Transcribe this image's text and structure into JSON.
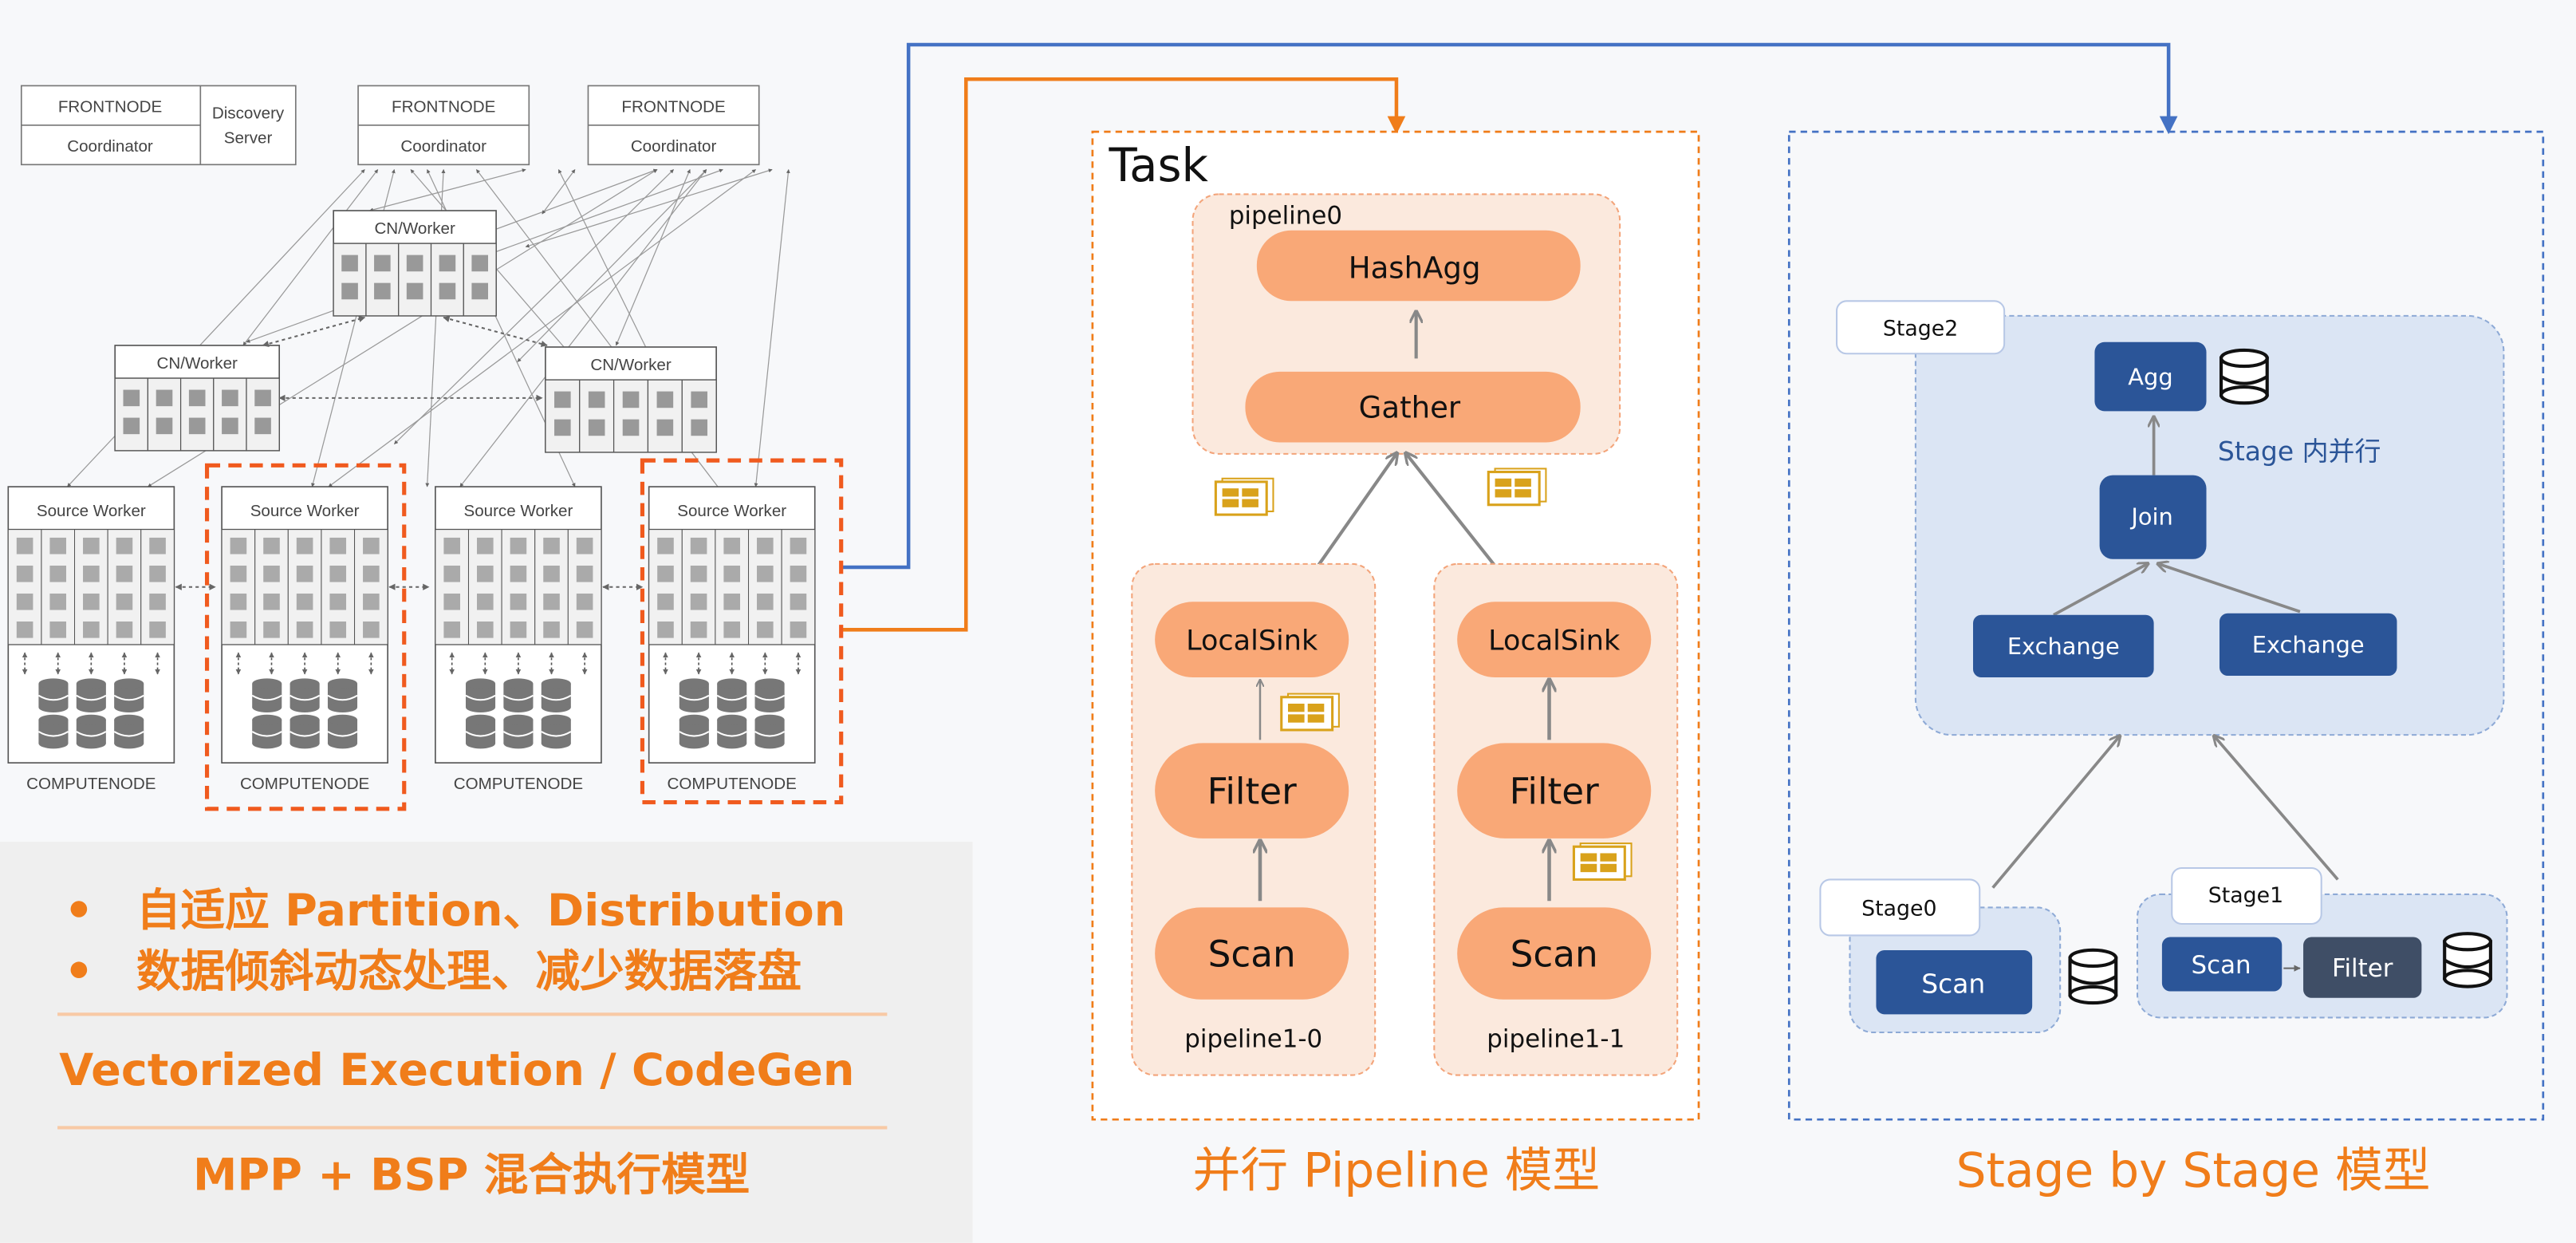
{
  "cluster": {
    "frontnodes": [
      {
        "title": "FRONTNODE",
        "role": "Coordinator"
      },
      {
        "title": "FRONTNODE",
        "role": "Coordinator"
      },
      {
        "title": "FRONTNODE",
        "role": "Coordinator"
      }
    ],
    "discovery_server": [
      "Discovery",
      "Server"
    ],
    "cn_worker_label": "CN/Worker",
    "source_worker_label": "Source Worker",
    "computenode_label": "COMPUTENODE"
  },
  "highlights": {
    "bullets": [
      "自适应 Partition、Distribution",
      "数据倾斜动态处理、减少数据落盘"
    ],
    "line2": "Vectorized Execution  / CodeGen",
    "line3": "MPP + BSP 混合执行模型"
  },
  "pipeline_model": {
    "task_label": "Task",
    "pipeline0": {
      "label": "pipeline0",
      "ops": [
        "HashAgg",
        "Gather"
      ]
    },
    "pipeline1_0": {
      "label": "pipeline1-0",
      "ops": [
        "LocalSink",
        "Filter",
        "Scan"
      ]
    },
    "pipeline1_1": {
      "label": "pipeline1-1",
      "ops": [
        "LocalSink",
        "Filter",
        "Scan"
      ]
    },
    "caption": "并行 Pipeline 模型"
  },
  "stage_model": {
    "stage2": {
      "label": "Stage2",
      "ops": {
        "agg": "Agg",
        "join": "Join",
        "exchange_left": "Exchange",
        "exchange_right": "Exchange"
      },
      "note": "Stage 内并行"
    },
    "stage0": {
      "label": "Stage0",
      "ops": {
        "scan": "Scan"
      }
    },
    "stage1": {
      "label": "Stage1",
      "ops": {
        "scan": "Scan",
        "filter": "Filter"
      }
    },
    "caption": "Stage by Stage 模型"
  },
  "colors": {
    "orange": "#f07d1a",
    "pipeline_op": "#f9a877",
    "pipeline_bg": "#fbe9dd",
    "stage_blue": "#2b5598",
    "stage_bg": "#dbe5f4",
    "filter_dark": "#3f4e66",
    "highlight_dash": "#f05a1e",
    "link_blue": "#4472c4"
  },
  "icons": [
    "database-icon",
    "data-batch-icon",
    "arrow-icon"
  ]
}
